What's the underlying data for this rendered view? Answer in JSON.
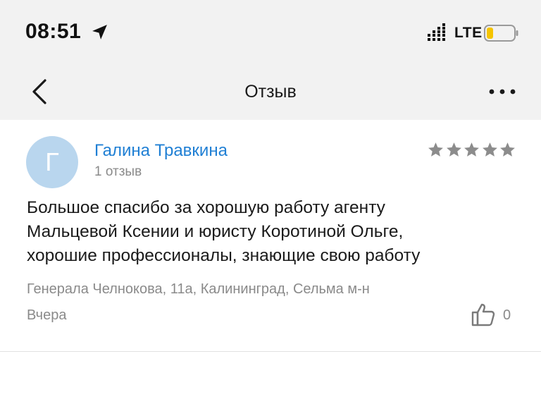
{
  "status_bar": {
    "time": "08:51",
    "network": "LTE",
    "icons": [
      "location-arrow-icon",
      "signal-icon",
      "battery-icon"
    ],
    "battery_color": "#f5c400"
  },
  "nav": {
    "title": "Отзыв",
    "back_icon": "chevron-left-icon",
    "more_icon": "more-horizontal-icon"
  },
  "review": {
    "avatar_letter": "Г",
    "avatar_color": "#b9d6ee",
    "author": "Галина Травкина",
    "author_color": "#1f7fd4",
    "reviews_count": "1 отзыв",
    "rating": 5,
    "star_color": "#8c8c8c",
    "text_lines": [
      "Большое спасибо за хорошую работу агенту",
      "Мальцевой Ксении и юристу Коротиной Ольге,",
      "хорошие профессионалы, знающие свою работу"
    ],
    "address": "Генерала Челнокова, 11а, Калининград, Сельма м-н",
    "date": "Вчера",
    "likes": "0",
    "like_icon": "thumbs-up-icon"
  }
}
